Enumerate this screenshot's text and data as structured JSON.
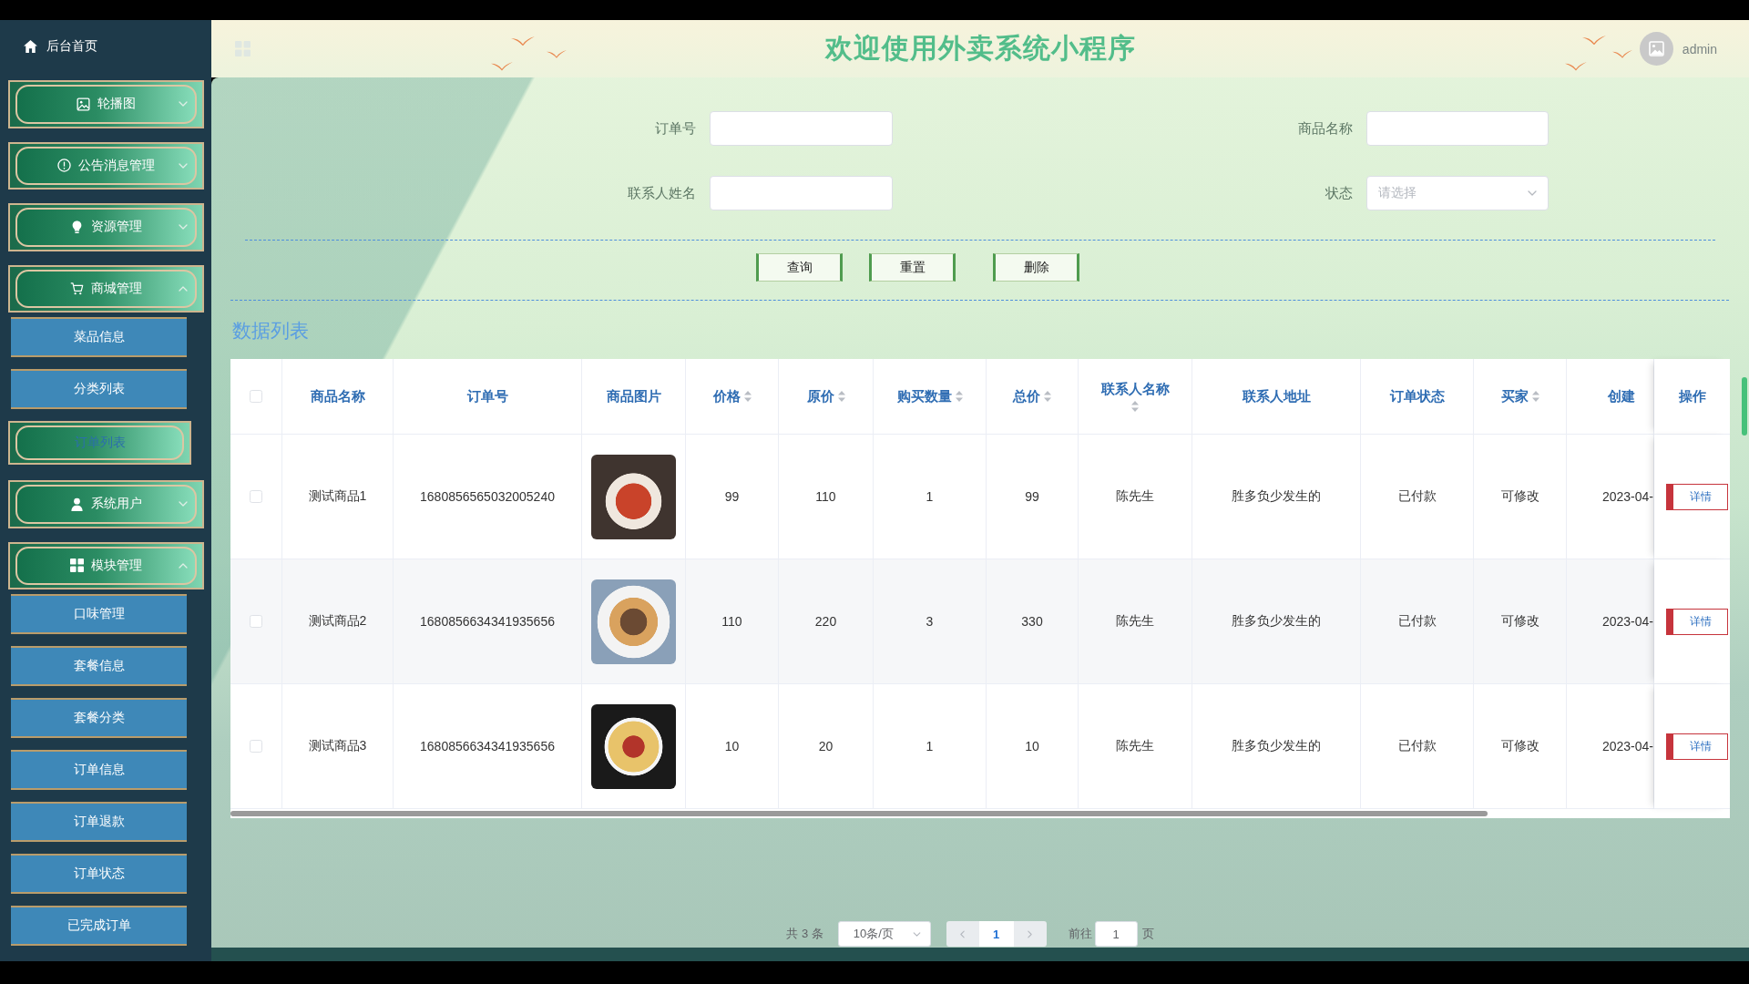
{
  "sidebar": {
    "home": "后台首页",
    "menus": [
      {
        "label": "轮播图",
        "expanded": false
      },
      {
        "label": "公告消息管理",
        "expanded": false
      },
      {
        "label": "资源管理",
        "expanded": false
      },
      {
        "label": "商城管理",
        "expanded": true,
        "children": [
          {
            "label": "菜品信息",
            "selected": false
          },
          {
            "label": "分类列表",
            "selected": false
          },
          {
            "label": "订单列表",
            "selected": true
          }
        ]
      },
      {
        "label": "系统用户",
        "expanded": false
      },
      {
        "label": "模块管理",
        "expanded": true,
        "children": [
          {
            "label": "口味管理",
            "selected": false
          },
          {
            "label": "套餐信息",
            "selected": false
          },
          {
            "label": "套餐分类",
            "selected": false
          },
          {
            "label": "订单信息",
            "selected": false
          },
          {
            "label": "订单退款",
            "selected": false
          },
          {
            "label": "订单状态",
            "selected": false
          },
          {
            "label": "已完成订单",
            "selected": false
          }
        ]
      }
    ]
  },
  "header": {
    "title": "欢迎使用外卖系统小程序",
    "user": "admin"
  },
  "search": {
    "fields": [
      {
        "kind": "input",
        "label": "订单号"
      },
      {
        "kind": "input",
        "label": "商品名称"
      },
      {
        "kind": "input",
        "label": "联系人姓名"
      },
      {
        "kind": "select",
        "label": "状态",
        "placeholder": "请选择"
      }
    ],
    "buttons": [
      "查询",
      "重置",
      "删除"
    ]
  },
  "table": {
    "title": "数据列表",
    "select_all": {
      "checked": false
    },
    "columns": [
      {
        "label": "商品名称",
        "kind": "plain"
      },
      {
        "label": "订单号",
        "kind": "plain"
      },
      {
        "label": "商品图片",
        "kind": "plain"
      },
      {
        "label": "价格",
        "kind": "sortable"
      },
      {
        "label": "原价",
        "kind": "sortable"
      },
      {
        "label": "购买数量",
        "kind": "sortable"
      },
      {
        "label": "总价",
        "kind": "sortable"
      },
      {
        "label": "联系人名称",
        "kind": "sortable"
      },
      {
        "label": "联系人地址",
        "kind": "plain"
      },
      {
        "label": "订单状态",
        "kind": "plain"
      },
      {
        "label": "买家",
        "kind": "sortable"
      },
      {
        "label": "创建",
        "kind": "plain"
      },
      {
        "label": "操作",
        "kind": "plain"
      }
    ],
    "rows": [
      {
        "checked": false,
        "name": "测试商品1",
        "order_no": "1680856565032005240",
        "price": "99",
        "original_price": "110",
        "quantity": "1",
        "total": "99",
        "contact_name": "陈先生",
        "contact_address": "胜多负少发生的",
        "order_status": "已付款",
        "buyer": "可修改",
        "created": "2023-04-",
        "action": "详情"
      },
      {
        "checked": false,
        "name": "测试商品2",
        "order_no": "1680856634341935656",
        "price": "110",
        "original_price": "220",
        "quantity": "3",
        "total": "330",
        "contact_name": "陈先生",
        "contact_address": "胜多负少发生的",
        "order_status": "已付款",
        "buyer": "可修改",
        "created": "2023-04-",
        "action": "详情"
      },
      {
        "checked": false,
        "name": "测试商品3",
        "order_no": "1680856634341935656",
        "price": "10",
        "original_price": "20",
        "quantity": "1",
        "total": "10",
        "contact_name": "陈先生",
        "contact_address": "胜多负少发生的",
        "order_status": "已付款",
        "buyer": "可修改",
        "created": "2023-04-",
        "action": "详情"
      }
    ]
  },
  "pagination": {
    "total": "共 3 条",
    "page_size": "10条/页",
    "pages": [
      {
        "label": "1",
        "selected": true
      }
    ],
    "goto_label": "前往",
    "goto_value": "1",
    "goto_suffix": "页"
  }
}
